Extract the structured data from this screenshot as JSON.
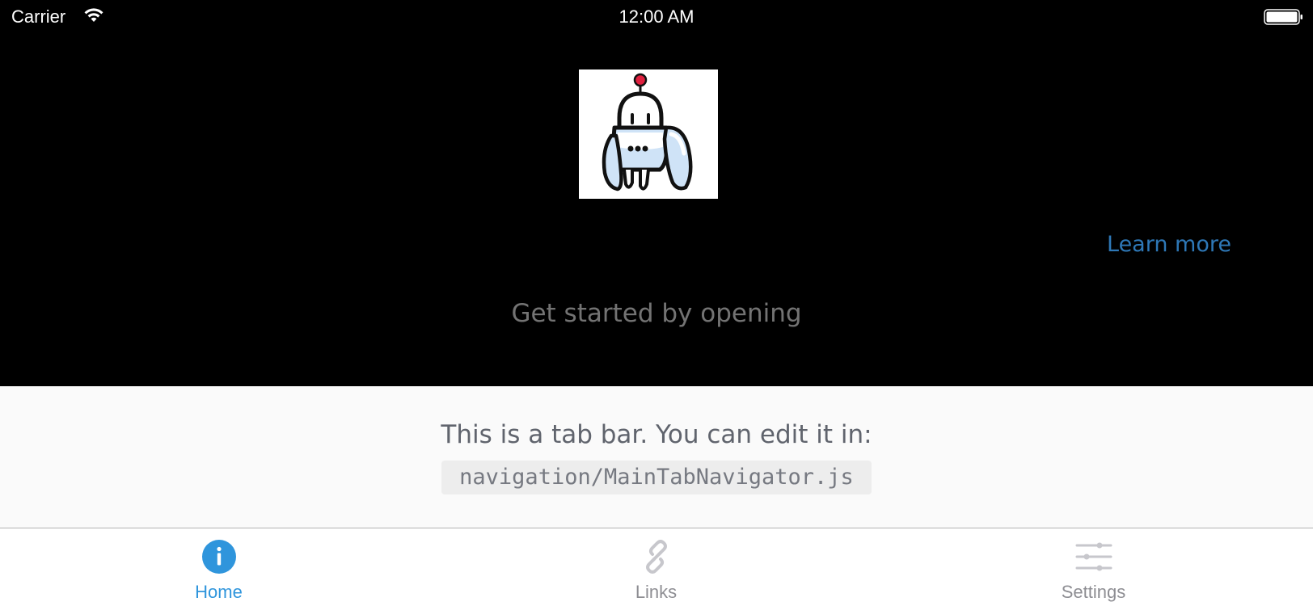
{
  "status_bar": {
    "carrier": "Carrier",
    "time": "12:00 AM",
    "wifi_icon": "wifi-icon",
    "battery_icon": "battery-icon"
  },
  "main": {
    "image_icon": "robot-welcome-icon",
    "learn_more": "Learn more",
    "get_started": "Get started by opening"
  },
  "info_panel": {
    "text": "This is a tab bar. You can edit it in:",
    "code_path": "navigation/MainTabNavigator.js"
  },
  "tab_bar": {
    "tabs": [
      {
        "label": "Home",
        "icon": "info-icon",
        "active": true
      },
      {
        "label": "Links",
        "icon": "link-icon",
        "active": false
      },
      {
        "label": "Settings",
        "icon": "sliders-icon",
        "active": false
      }
    ]
  },
  "colors": {
    "accent": "#2f95dc",
    "link": "#2e78b7",
    "inactive": "#8e8e93"
  }
}
